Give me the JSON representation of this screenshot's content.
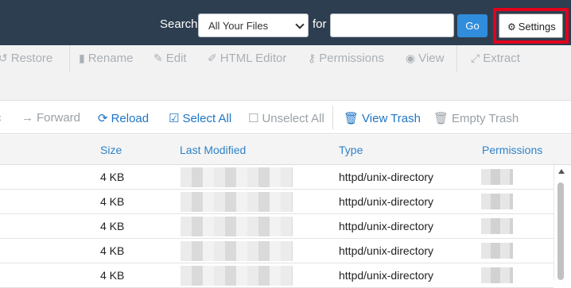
{
  "header": {
    "search_label": "Search",
    "search_scope": "All Your Files",
    "for_label": "for",
    "search_value": "",
    "go_label": "Go",
    "settings_label": "Settings",
    "highlight_color": "#e3001b"
  },
  "toolbar": {
    "restore": "Restore",
    "rename": "Rename",
    "edit": "Edit",
    "html_editor": "HTML Editor",
    "permissions": "Permissions",
    "view": "View",
    "extract": "Extract"
  },
  "nav": {
    "forward": "Forward",
    "reload": "Reload",
    "select_all": "Select All",
    "unselect_all": "Unselect All",
    "view_trash": "View Trash",
    "empty_trash": "Empty Trash"
  },
  "table": {
    "columns": [
      "Size",
      "Last Modified",
      "Type",
      "Permissions"
    ],
    "rows": [
      {
        "size": "4 KB",
        "type": "httpd/unix-directory"
      },
      {
        "size": "4 KB",
        "type": "httpd/unix-directory"
      },
      {
        "size": "4 KB",
        "type": "httpd/unix-directory"
      },
      {
        "size": "4 KB",
        "type": "httpd/unix-directory"
      },
      {
        "size": "4 KB",
        "type": "httpd/unix-directory"
      }
    ]
  }
}
